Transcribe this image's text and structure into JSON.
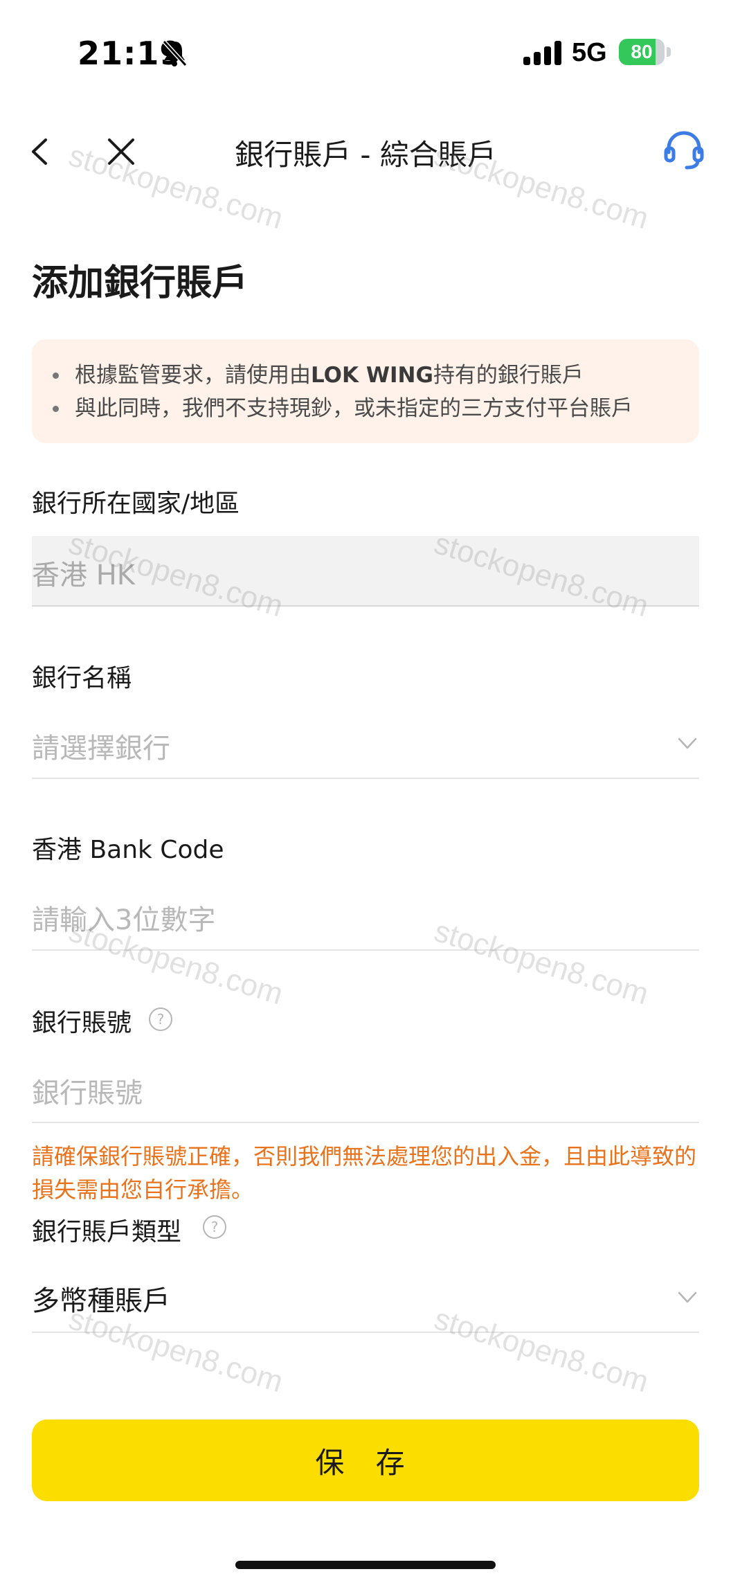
{
  "status_bar": {
    "time": "21:19",
    "network": "5G",
    "battery_level": 80,
    "battery_text": "80"
  },
  "nav": {
    "title": "銀行賬戶 - 綜合賬戶",
    "back_icon": "chevron-left-icon",
    "close_icon": "close-icon",
    "support_icon": "headset-icon"
  },
  "page_title": "添加銀行賬戶",
  "notice": {
    "line1_prefix": "根據監管要求，請使用由",
    "line1_bold": "LOK WING",
    "line1_suffix": "持有的銀行賬戶",
    "line2": "與此同時，我們不支持現鈔，或未指定的三方支付平台賬戶"
  },
  "fields": {
    "country": {
      "label": "銀行所在國家/地區",
      "value": "香港 HK"
    },
    "bank_name": {
      "label": "銀行名稱",
      "placeholder": "請選擇銀行"
    },
    "bank_code": {
      "label": "香港 Bank Code",
      "placeholder": "請輸入3位數字"
    },
    "account_number": {
      "label": "銀行賬號",
      "placeholder": "銀行賬號"
    },
    "account_type": {
      "label": "銀行賬戶類型",
      "value": "多幣種賬戶"
    }
  },
  "warning": "請確保銀行賬號正確，否則我們無法處理您的出入金，且由此導致的損失需由您自行承擔。",
  "save_button": "保 存",
  "watermark": "stockopen8.com",
  "colors": {
    "accent_yellow": "#fbdd00",
    "warning_orange": "#e8731c",
    "notice_bg": "#fef2ea",
    "support_blue": "#3b7ce6",
    "battery_green": "#34c759"
  }
}
